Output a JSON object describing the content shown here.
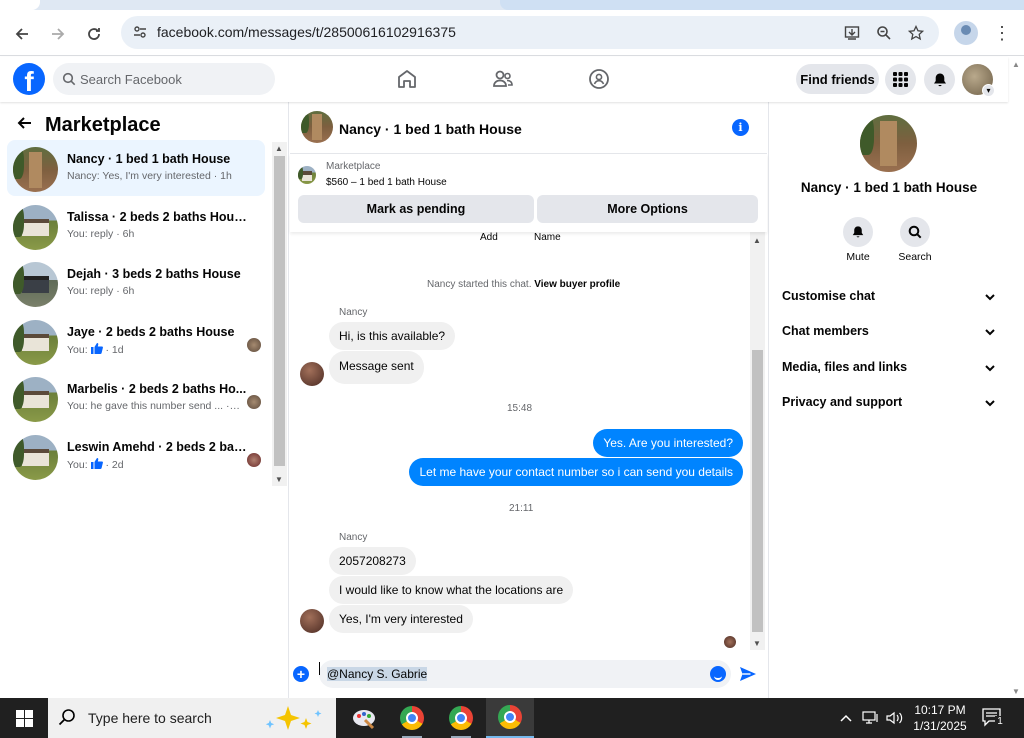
{
  "browser": {
    "url": "facebook.com/messages/t/28500616102916375"
  },
  "fb": {
    "search_placeholder": "Search Facebook",
    "find_friends": "Find friends",
    "logo": "f"
  },
  "left": {
    "title": "Marketplace",
    "conversations": [
      {
        "name": "Nancy · 1 bed 1 bath House",
        "preview": "Nancy: Yes, I'm very interested · 1h"
      },
      {
        "name": "Talissa · 2 beds 2 baths House",
        "preview": "You: reply · 6h"
      },
      {
        "name": "Dejah · 3 beds 2 baths House",
        "preview": "You: reply · 6h"
      },
      {
        "name": "Jaye · 2 beds 2 baths House",
        "preview_prefix": "You:",
        "preview_suffix": " · 1d"
      },
      {
        "name": "Marbelis · 2 beds 2 baths Ho...",
        "preview": "You: he gave this number send ... · 2d"
      },
      {
        "name": "Leswin Amehd · 2 beds 2 bat...",
        "preview_prefix": "You:",
        "preview_suffix": " · 2d"
      }
    ]
  },
  "chat": {
    "header_name": "Nancy · 1 bed 1 bath House",
    "info_glyph": "i",
    "marketplace_label": "Marketplace",
    "listing": "$560 – 1 bed 1 bath House",
    "mark_pending": "Mark as pending",
    "more_options": "More Options",
    "top_cut_1": "Add",
    "top_cut_2": "Name",
    "started_text": "Nancy started this chat.",
    "view_buyer": "View buyer profile",
    "sender_1": "Nancy",
    "msg_1": "Hi, is this available?",
    "msg_2": "Message sent",
    "time_1": "15:48",
    "out_1": "Yes. Are you interested?",
    "out_2": "Let me have your contact number so i can send you details",
    "time_2": "21:11",
    "sender_2": "Nancy",
    "msg_3": "2057208273",
    "msg_4": "I would like to know what the locations are",
    "msg_5": "Yes, I'm very interested",
    "composer_text": "@Nancy S. Gabrie"
  },
  "right": {
    "name": "Nancy · 1 bed 1 bath House",
    "mute": "Mute",
    "search": "Search",
    "rows": [
      "Customise chat",
      "Chat members",
      "Media, files and links",
      "Privacy and support"
    ]
  },
  "taskbar": {
    "search_placeholder": "Type here to search",
    "time": "10:17 PM",
    "date": "1/31/2025",
    "notif_count": "1"
  },
  "colors": {
    "fb_blue": "#0866ff",
    "outgoing_bubble": "#0084ff",
    "incoming_bubble": "#f0f0f0",
    "active_conversation": "#ebf5ff"
  }
}
